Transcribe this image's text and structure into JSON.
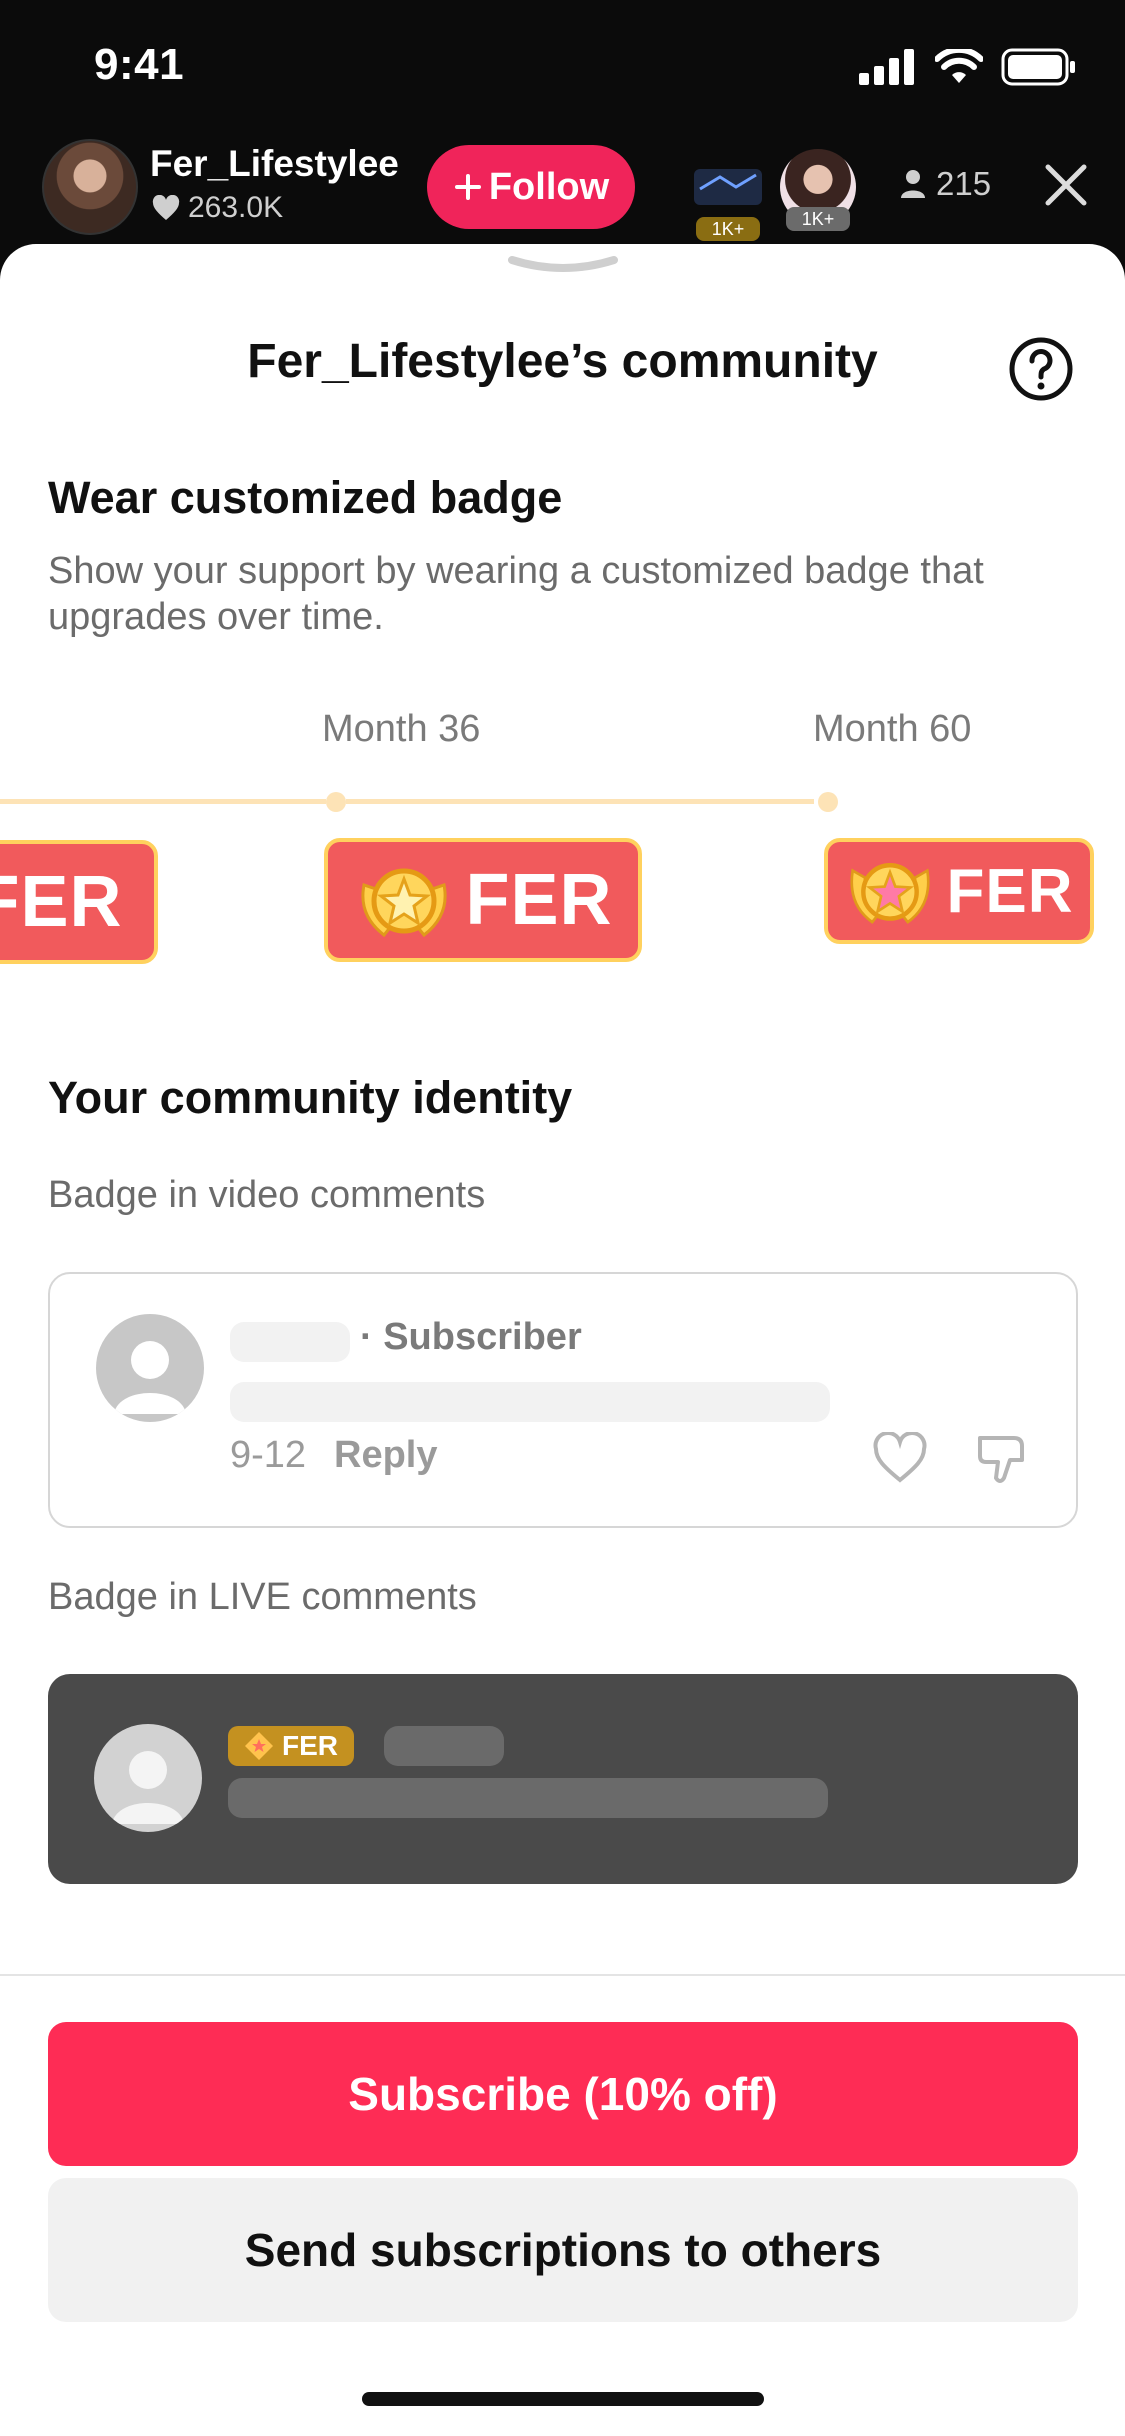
{
  "status_bar": {
    "time": "9:41"
  },
  "live_header": {
    "host_name": "Fer_Lifestylee",
    "host_likes": "263.0K",
    "follow_label": "Follow",
    "viewer_tags": [
      "1K+",
      "1K+"
    ],
    "viewer_count": "215"
  },
  "sheet": {
    "title": "Fer_Lifestylee’s community",
    "badge_section": {
      "heading": "Wear customized badge",
      "description": "Show your support by wearing a customized badge that upgrades over time.",
      "milestones": [
        {
          "label": "Month 36",
          "badge_text": "FER"
        },
        {
          "label": "Month 60",
          "badge_text": "FER"
        }
      ],
      "partial_badge_text": "FER"
    },
    "identity_section": {
      "heading": "Your community identity",
      "video_caption": "Badge in video comments",
      "video_comment": {
        "subscriber_label": "· Subscriber",
        "date": "9-12",
        "reply_label": "Reply"
      },
      "live_caption": "Badge in LIVE comments",
      "live_comment": {
        "badge_text": "FER"
      }
    },
    "actions": {
      "subscribe_label": "Subscribe (10% off)",
      "gift_label": "Send subscriptions to others"
    }
  },
  "colors": {
    "accent": "#fe2c55",
    "follow": "#f0245a",
    "badge_fill": "#f15a5c",
    "badge_border": "#ffd15e",
    "track": "#fde3b6",
    "live_pill": "#c49120"
  }
}
